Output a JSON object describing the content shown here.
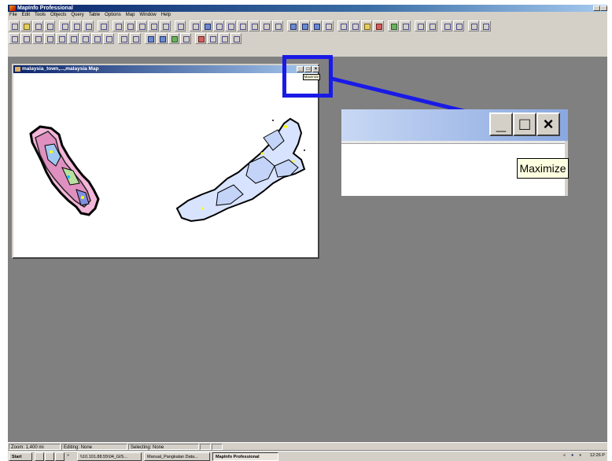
{
  "app": {
    "title": "MapInfo Professional"
  },
  "menu": [
    "File",
    "Edit",
    "Tools",
    "Objects",
    "Query",
    "Table",
    "Options",
    "Map",
    "Window",
    "Help"
  ],
  "map_window": {
    "title": "malaysia_town,...,malaysia Map",
    "minimize": "_",
    "maximize": "□",
    "close": "×",
    "tooltip": "Maximize"
  },
  "inset": {
    "minimize": "_",
    "maximize": "□",
    "close": "×",
    "tooltip": "Maximize"
  },
  "status": {
    "zoom": "Zoom: 1,400 mi",
    "editing": "Editing: None",
    "selecting": "Selecting: None"
  },
  "taskbar": {
    "start": "Start",
    "chevron": "»",
    "task1": "\\\\10.101.88.55\\04_GIS...",
    "task2": "Manual_Pangkalan Data...",
    "task3": "MapInfo Professional",
    "tray_arrows": "«",
    "clock": "12:26 P"
  },
  "colors": {
    "highlight": "#1a1ae6",
    "arrow": "#1a1ae6",
    "desktop": "#808080"
  }
}
